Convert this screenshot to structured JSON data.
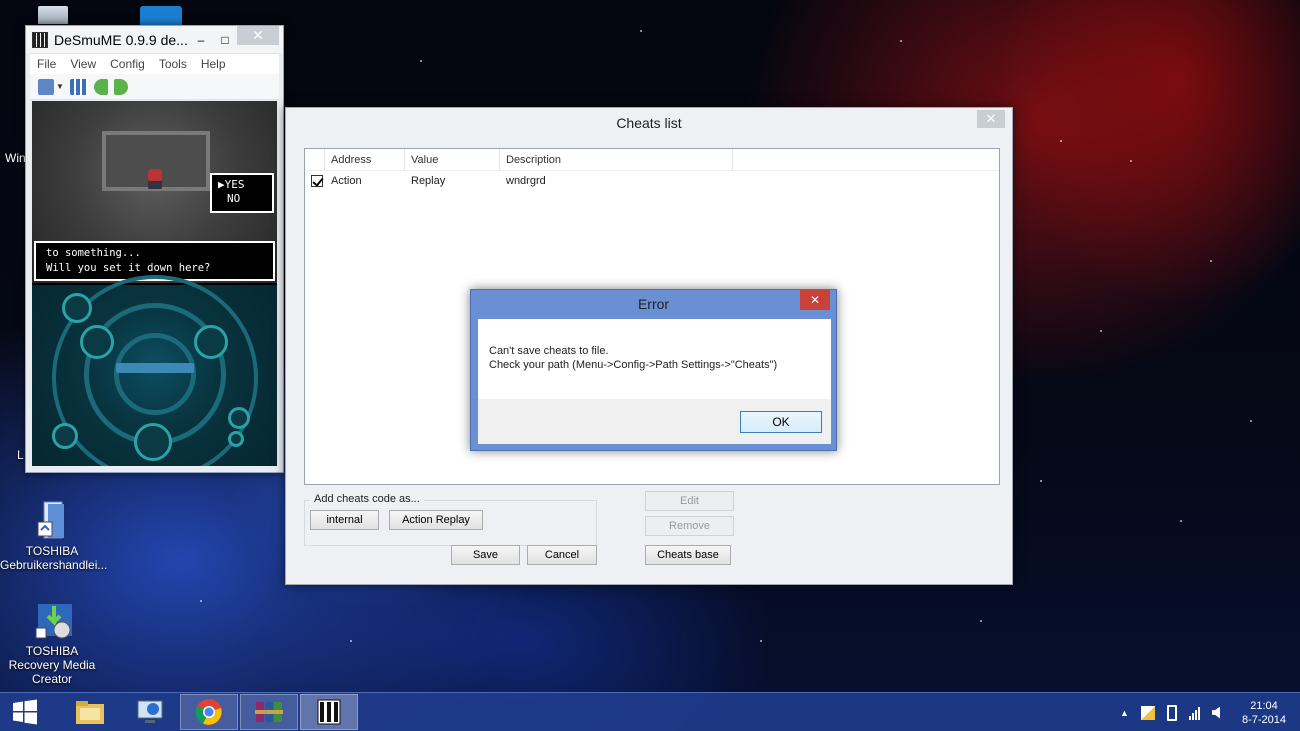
{
  "desktop": {
    "icons": [
      {
        "label": "TOSHIBA Gebruikershandlei...",
        "icon": "manual-book-icon"
      },
      {
        "label": "TOSHIBA Recovery Media Creator",
        "icon": "recovery-media-icon"
      }
    ],
    "partial_labels": [
      "Win",
      "L"
    ]
  },
  "emulator": {
    "title": "DeSmuME 0.9.9 de...",
    "controls": {
      "minimize": "–",
      "maximize": "□",
      "close": "✕"
    },
    "menu": [
      "File",
      "View",
      "Config",
      "Tools",
      "Help"
    ],
    "game": {
      "choice_yes": "YES",
      "choice_no": "NO",
      "dialog_line1": "to something...",
      "dialog_line2": "Will you set it down here?"
    }
  },
  "cheats": {
    "title": "Cheats list",
    "close": "✕",
    "columns": [
      "Address",
      "Value",
      "Description"
    ],
    "rows": [
      {
        "checked": true,
        "address": "Action",
        "value": "Replay",
        "description": "wndrgrd"
      }
    ],
    "group_label": "Add cheats code as...",
    "btn_internal": "internal",
    "btn_action_replay": "Action Replay",
    "btn_edit": "Edit",
    "btn_remove": "Remove",
    "btn_save": "Save",
    "btn_cancel": "Cancel",
    "btn_cheats_base": "Cheats base"
  },
  "error": {
    "title": "Error",
    "close": "✕",
    "line1": "Can't save cheats to file.",
    "line2": "Check your path (Menu->Config->Path Settings->\"Cheats\")",
    "ok": "OK"
  },
  "taskbar": {
    "apps": [
      "start-icon",
      "file-explorer-icon",
      "remote-desktop-icon",
      "chrome-icon",
      "winrar-icon",
      "desmume-icon"
    ],
    "clock_time": "21:04",
    "clock_date": "8-7-2014"
  }
}
